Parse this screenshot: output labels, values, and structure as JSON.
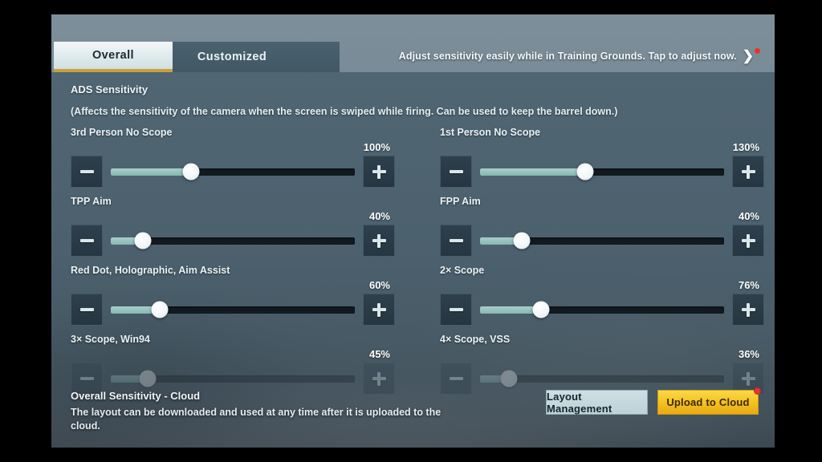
{
  "tabs": [
    {
      "label": "Overall",
      "active": true
    },
    {
      "label": "Customized",
      "active": false
    }
  ],
  "header": {
    "hint": "Adjust sensitivity easily while in Training Grounds. Tap to adjust now.",
    "chevron": "chevron-right-icon",
    "badge_color": "#e8342a"
  },
  "section": {
    "title": "ADS Sensitivity",
    "description": "(Affects the sensitivity of the camera when the screen is swiped while firing. Can be used to keep the barrel down.)"
  },
  "sliders": [
    {
      "label": "3rd Person No Scope",
      "value": "100%",
      "fill_pct": 33,
      "column": "left",
      "row": 0,
      "faded": false
    },
    {
      "label": "1st Person No Scope",
      "value": "130%",
      "fill_pct": 43,
      "column": "right",
      "row": 0,
      "faded": false
    },
    {
      "label": "TPP Aim",
      "value": "40%",
      "fill_pct": 13,
      "column": "left",
      "row": 1,
      "faded": false
    },
    {
      "label": "FPP Aim",
      "value": "40%",
      "fill_pct": 17,
      "column": "right",
      "row": 1,
      "faded": false
    },
    {
      "label": "Red Dot, Holographic, Aim Assist",
      "value": "60%",
      "fill_pct": 20,
      "column": "left",
      "row": 2,
      "faded": false
    },
    {
      "label": "2× Scope",
      "value": "76%",
      "fill_pct": 25,
      "column": "right",
      "row": 2,
      "faded": false
    },
    {
      "label": "3× Scope, Win94",
      "value": "45%",
      "fill_pct": 15,
      "column": "left",
      "row": 3,
      "faded": true
    },
    {
      "label": "4× Scope, VSS",
      "value": "36%",
      "fill_pct": 12,
      "column": "right",
      "row": 3,
      "faded": true
    }
  ],
  "stepper": {
    "minus_icon": "minus-icon",
    "plus_icon": "plus-icon"
  },
  "footer": {
    "title": "Overall Sensitivity - Cloud",
    "description": "The layout can be downloaded and used at any time after it is uploaded to the cloud.",
    "layout_button": "Layout Management",
    "upload_button": "Upload to Cloud",
    "upload_badge_color": "#e8342a"
  },
  "colors": {
    "accent_gold": "#f5c522",
    "track_fill": "#8fc0bc",
    "track_empty": "#121a20",
    "panel": "#465c69"
  }
}
